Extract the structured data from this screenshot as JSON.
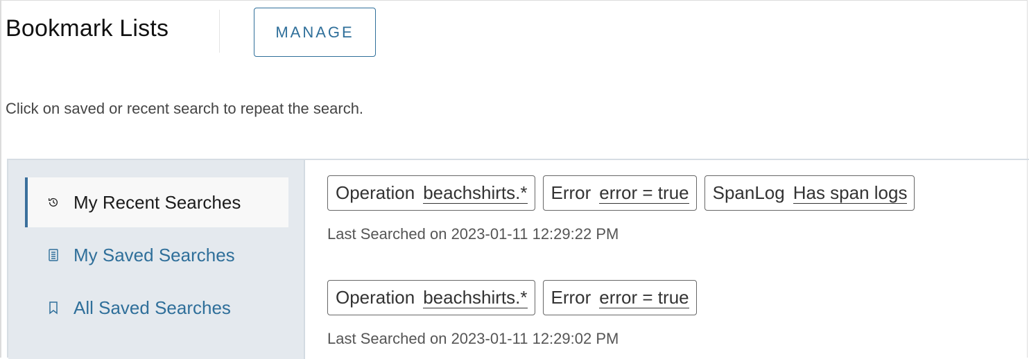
{
  "header": {
    "title": "Bookmark Lists",
    "manage_label": "MANAGE"
  },
  "hint": "Click on saved or recent search to repeat the search.",
  "sidebar": {
    "items": [
      {
        "label": "My Recent Searches",
        "icon": "history-icon",
        "active": true
      },
      {
        "label": "My Saved Searches",
        "icon": "document-list-icon",
        "active": false
      },
      {
        "label": "All Saved Searches",
        "icon": "bookmark-icon",
        "active": false
      }
    ]
  },
  "recent": [
    {
      "chips": [
        {
          "key": "Operation",
          "value": "beachshirts.*"
        },
        {
          "key": "Error",
          "value": "error = true"
        },
        {
          "key": "SpanLog",
          "value": "Has span logs"
        }
      ],
      "last_searched": "Last Searched on 2023-01-11 12:29:22 PM"
    },
    {
      "chips": [
        {
          "key": "Operation",
          "value": "beachshirts.*"
        },
        {
          "key": "Error",
          "value": "error = true"
        }
      ],
      "last_searched": "Last Searched on 2023-01-11 12:29:02 PM"
    }
  ],
  "colors": {
    "accent": "#2f6f9a",
    "sidebar_bg": "#e4e9ee",
    "active_bar": "#3a6f9c"
  }
}
